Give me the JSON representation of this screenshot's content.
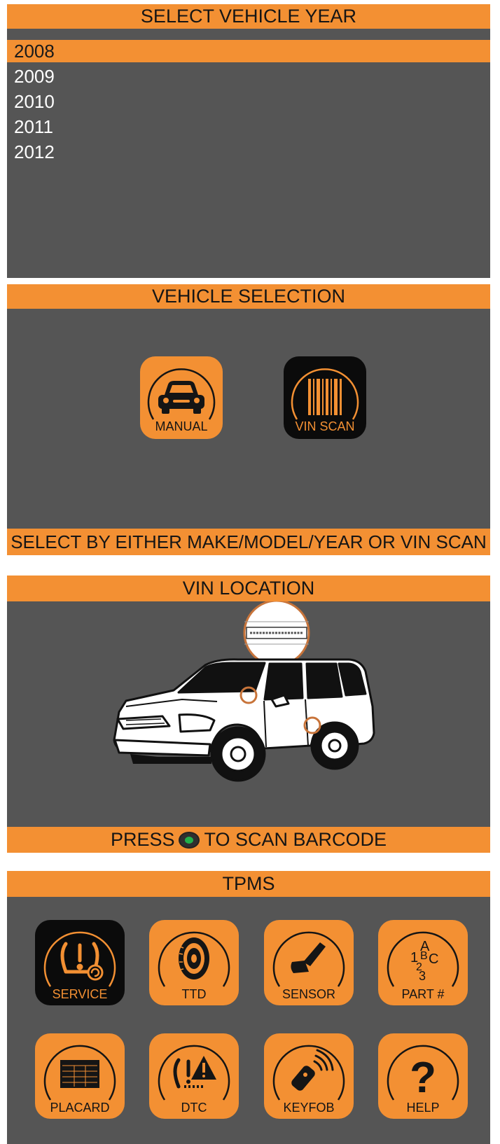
{
  "year_screen": {
    "title": "SELECT VEHICLE YEAR",
    "years": [
      "2008",
      "2009",
      "2010",
      "2011",
      "2012"
    ],
    "selected_year": "2008"
  },
  "vehicle_selection": {
    "title": "VEHICLE SELECTION",
    "manual_label": "MANUAL",
    "manual_icon": "car-icon",
    "vin_scan_label": "VIN SCAN",
    "vin_scan_icon": "barcode-icon",
    "footer": "SELECT BY EITHER MAKE/MODEL/YEAR OR VIN SCAN"
  },
  "vin_location": {
    "title": "VIN LOCATION",
    "footer_before": "PRESS",
    "footer_button_icon": "green-scan-button-icon",
    "footer_after": "TO SCAN BARCODE"
  },
  "tpms": {
    "title": "TPMS",
    "items": [
      {
        "label": "SERVICE",
        "icon": "tpms-warning-icon",
        "selected": true
      },
      {
        "label": "TTD",
        "icon": "tire-icon",
        "selected": false
      },
      {
        "label": "SENSOR",
        "icon": "sensor-icon",
        "selected": false
      },
      {
        "label": "PART #",
        "icon": "part-number-icon",
        "selected": false
      },
      {
        "label": "PLACARD",
        "icon": "placard-icon",
        "selected": false
      },
      {
        "label": "DTC",
        "icon": "dtc-warning-icon",
        "selected": false
      },
      {
        "label": "KEYFOB",
        "icon": "keyfob-icon",
        "selected": false
      },
      {
        "label": "HELP",
        "icon": "help-icon",
        "selected": false
      }
    ]
  },
  "colors": {
    "accent_orange": "#f39033",
    "screen_gray": "#555555",
    "selected_tile_black": "#0b0b0b"
  }
}
